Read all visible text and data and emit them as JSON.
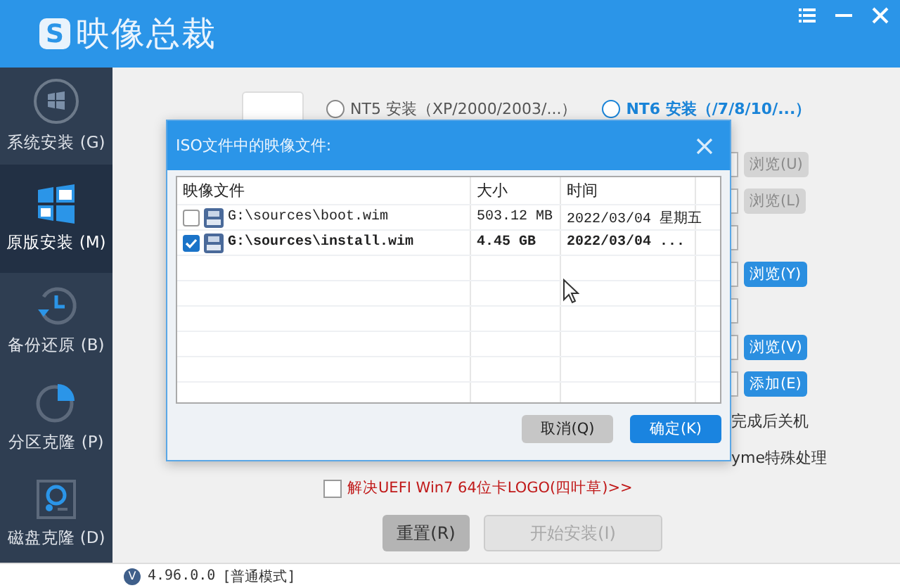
{
  "app": {
    "logo_mark": "S",
    "title": "映像总裁"
  },
  "sidebar": {
    "items": [
      {
        "kind": "system",
        "label": "系统安装 (G)",
        "selected": false
      },
      {
        "kind": "original",
        "label": "原版安装 (M)",
        "selected": true
      },
      {
        "kind": "backup",
        "label": "备份还原 (B)",
        "selected": false
      },
      {
        "kind": "partition",
        "label": "分区克隆 (P)",
        "selected": false
      },
      {
        "kind": "disk",
        "label": "磁盘克隆 (D)",
        "selected": false
      }
    ]
  },
  "mode_options": [
    {
      "label": "NT5 安装（XP/2000/2003/...）",
      "selected": false
    },
    {
      "label": "NT6 安装（/7/8/10/...）",
      "selected": true
    }
  ],
  "right_rows": [
    {
      "kind": "button",
      "label": "浏览(U)",
      "disabled": true
    },
    {
      "kind": "button",
      "label": "浏览(L)",
      "disabled": true
    },
    {
      "kind": "field"
    },
    {
      "kind": "button",
      "label": "浏览(Y)",
      "disabled": false
    },
    {
      "kind": "field"
    },
    {
      "kind": "button",
      "label": "浏览(V)",
      "disabled": false
    },
    {
      "kind": "button",
      "label": "添加(E)",
      "disabled": false
    },
    {
      "kind": "option",
      "label": "完成后关机"
    },
    {
      "kind": "option",
      "label": "yme特殊处理"
    }
  ],
  "uefi_fix": {
    "label": "解决UEFI Win7 64位卡LOGO(四叶草)>>",
    "checked": false
  },
  "actions": [
    {
      "label": "重置(R)",
      "disabled": false
    },
    {
      "label": "开始安装(I)",
      "disabled": true
    }
  ],
  "status_bar": {
    "badge": "V",
    "version": "4.96.0.0",
    "mode": "[普通模式]"
  },
  "dialog": {
    "title": "ISO文件中的映像文件:",
    "columns": [
      "映像文件",
      "大小",
      "时间"
    ],
    "rows": [
      {
        "file": "G:\\sources\\boot.wim",
        "size": "503.12 MB",
        "time": "2022/03/04 星期五",
        "checked": false
      },
      {
        "file": "G:\\sources\\install.wim",
        "size": "4.45 GB",
        "time": "2022/03/04 ...",
        "checked": true
      }
    ],
    "buttons": [
      {
        "label": "取消(Q)",
        "kind": "secondary"
      },
      {
        "label": "确定(K)",
        "kind": "primary"
      }
    ]
  }
}
